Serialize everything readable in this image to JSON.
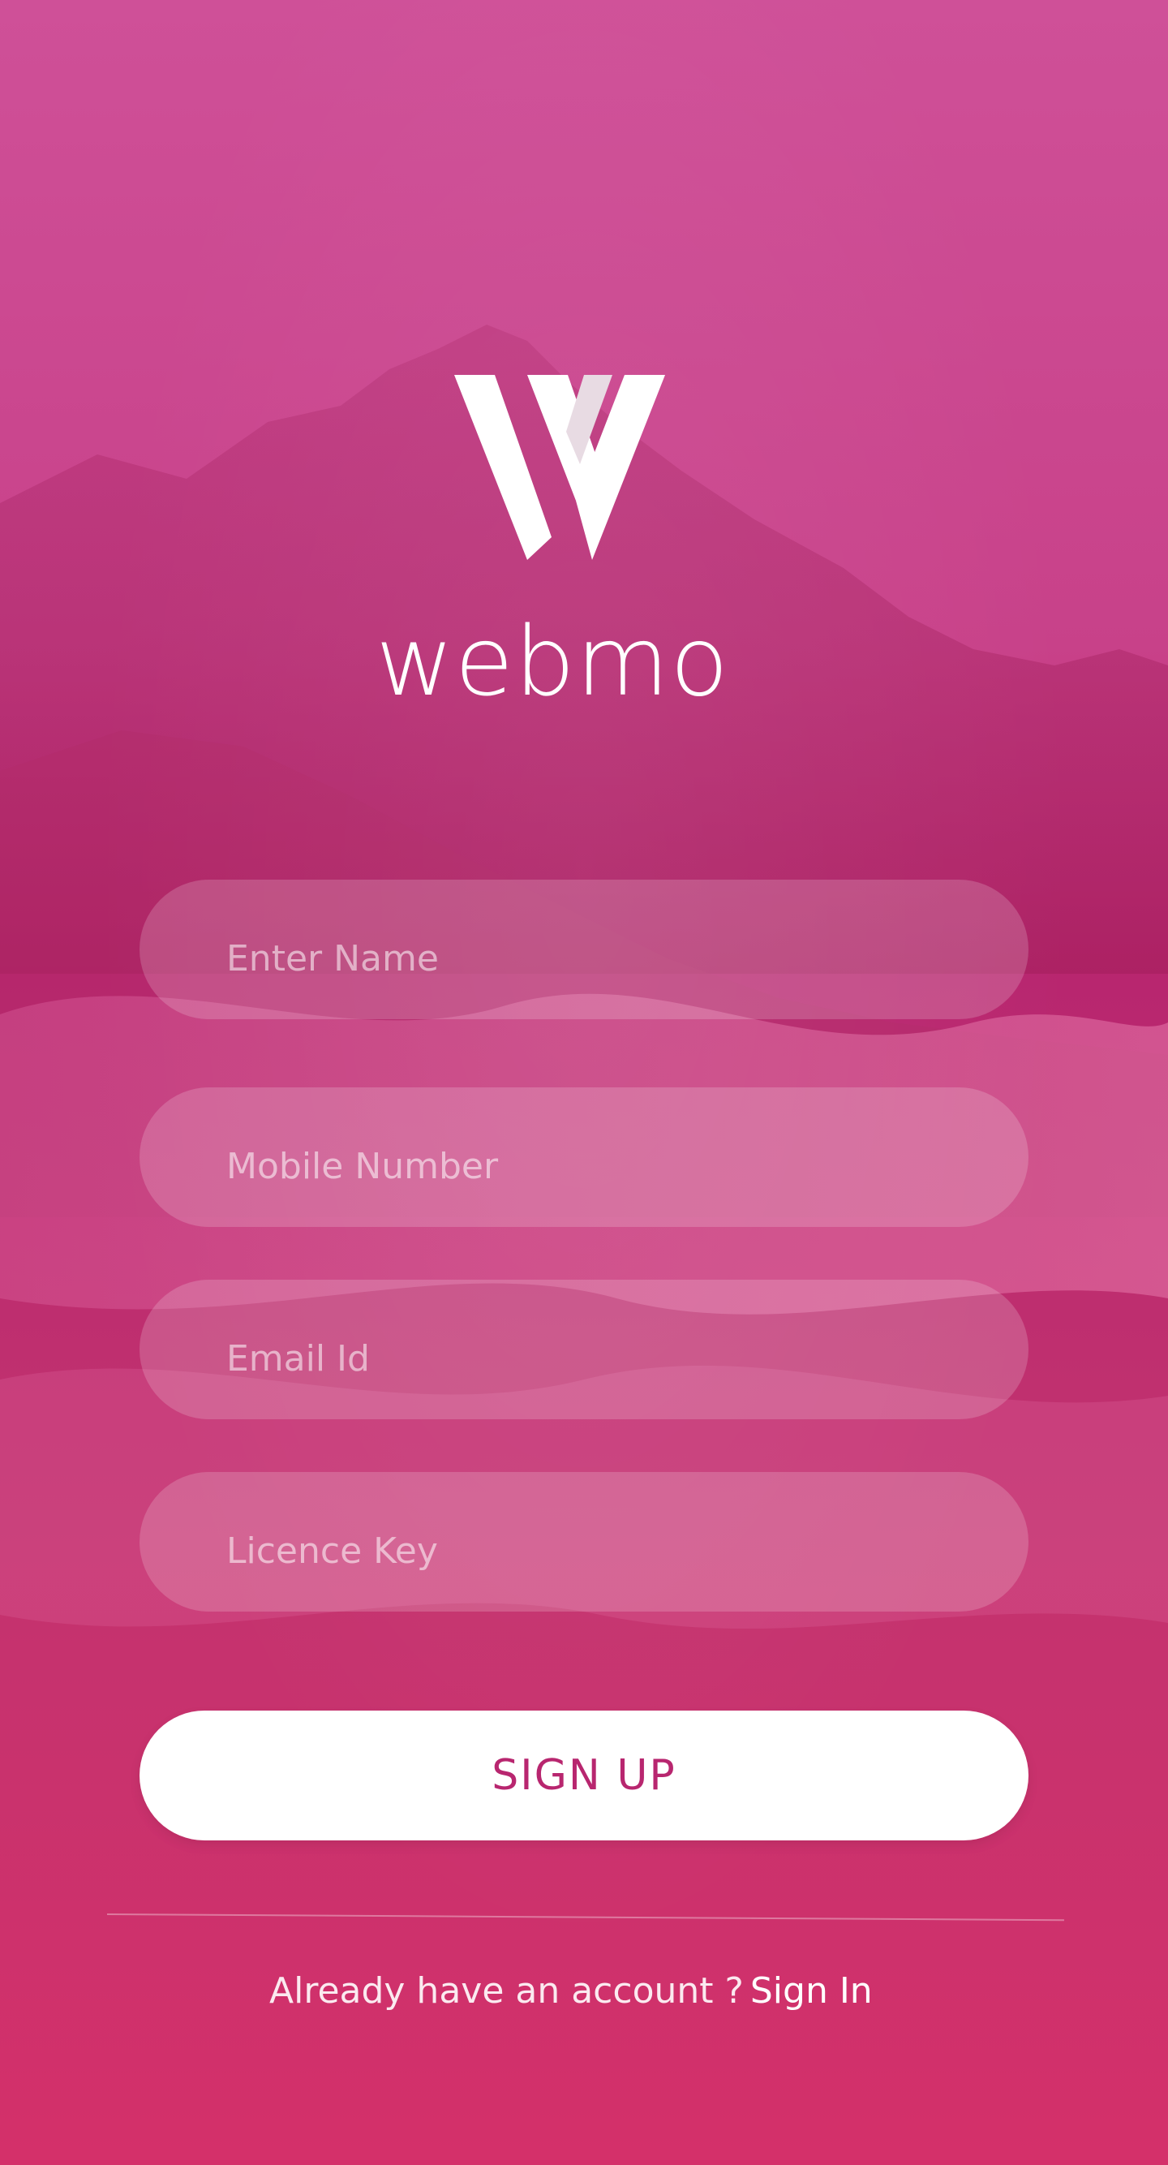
{
  "app": {
    "brand_name": "webmo"
  },
  "form": {
    "fields": [
      {
        "placeholder": "Enter Name"
      },
      {
        "placeholder": "Mobile Number"
      },
      {
        "placeholder": "Email Id"
      },
      {
        "placeholder": "Licence Key"
      }
    ],
    "submit_label": "SIGN UP"
  },
  "footer": {
    "prompt": "Already have an account ?",
    "link_label": "Sign In"
  },
  "colors": {
    "accent": "#b8266f",
    "background_top": "#cf5098",
    "background_bottom": "#d4306a",
    "button_bg": "#ffffff"
  },
  "icons": {
    "logo": "webmo-w-logo-icon"
  }
}
